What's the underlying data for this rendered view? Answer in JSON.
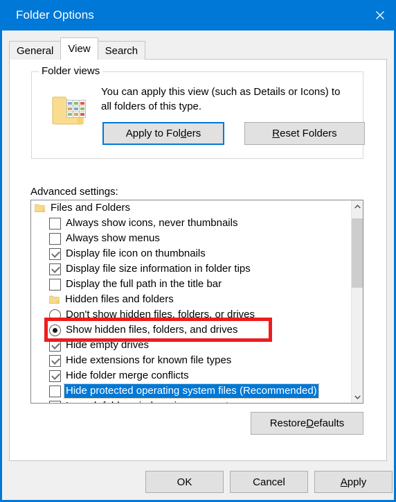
{
  "window": {
    "title": "Folder Options",
    "close_icon": "close-icon",
    "accent_color": "#0078d7"
  },
  "tabs": [
    {
      "label": "General",
      "active": false
    },
    {
      "label": "View",
      "active": true
    },
    {
      "label": "Search",
      "active": false
    }
  ],
  "folder_views": {
    "legend": "Folder views",
    "icon": "folder-thumbnails-icon",
    "description": "You can apply this view (such as Details or Icons) to all folders of this type.",
    "apply_button": {
      "before": "Apply to Fol",
      "accel": "d",
      "after": "ers"
    },
    "reset_button": {
      "before": "",
      "accel": "R",
      "after": "eset Folders"
    }
  },
  "advanced": {
    "label": "Advanced settings:",
    "rows": [
      {
        "type": "group",
        "label": "Files and Folders"
      },
      {
        "type": "checkbox",
        "label": "Always show icons, never thumbnails",
        "checked": false
      },
      {
        "type": "checkbox",
        "label": "Always show menus",
        "checked": false
      },
      {
        "type": "checkbox",
        "label": "Display file icon on thumbnails",
        "checked": true
      },
      {
        "type": "checkbox",
        "label": "Display file size information in folder tips",
        "checked": true
      },
      {
        "type": "checkbox",
        "label": "Display the full path in the title bar",
        "checked": false
      },
      {
        "type": "group",
        "label": "Hidden files and folders",
        "indent": true
      },
      {
        "type": "radio",
        "label": "Don't show hidden files, folders, or drives",
        "selected": false
      },
      {
        "type": "radio",
        "label": "Show hidden files, folders, and drives",
        "selected": true,
        "highlighted": true
      },
      {
        "type": "checkbox",
        "label": "Hide empty drives",
        "checked": true
      },
      {
        "type": "checkbox",
        "label": "Hide extensions for known file types",
        "checked": true
      },
      {
        "type": "checkbox",
        "label": "Hide folder merge conflicts",
        "checked": true
      },
      {
        "type": "checkbox",
        "label": "Hide protected operating system files (Recommended)",
        "checked": false,
        "selected": true
      },
      {
        "type": "checkbox",
        "label": "Launch folder windows in a separate process",
        "checked": false
      }
    ],
    "scrollbar": {
      "up_icon": "chevron-up-icon",
      "down_icon": "chevron-down-icon"
    },
    "restore_button": {
      "before": "Restore ",
      "accel": "D",
      "after": "efaults"
    }
  },
  "footer": {
    "ok": {
      "before": "OK",
      "accel": "",
      "after": ""
    },
    "cancel": {
      "before": "Cancel",
      "accel": "",
      "after": ""
    },
    "apply": {
      "before": "",
      "accel": "A",
      "after": "pply"
    }
  },
  "annotation": {
    "color": "#ee1c1c",
    "target_label": "Show hidden files, folders, and drives"
  }
}
